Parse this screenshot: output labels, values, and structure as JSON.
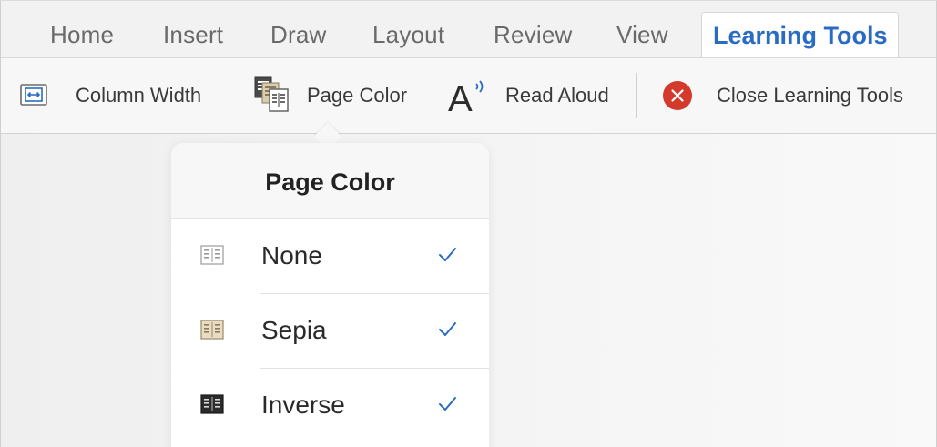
{
  "tabs": [
    {
      "label": "Home"
    },
    {
      "label": "Insert"
    },
    {
      "label": "Draw"
    },
    {
      "label": "Layout"
    },
    {
      "label": "Review"
    },
    {
      "label": "View"
    }
  ],
  "active_tab": {
    "label": "Learning Tools"
  },
  "ribbon": {
    "column_width": {
      "label": "Column Width",
      "icon": "column-width-icon"
    },
    "page_color": {
      "label": "Page Color",
      "icon": "page-color-icon"
    },
    "read_aloud": {
      "label": "Read Aloud",
      "icon": "read-aloud-icon"
    },
    "close": {
      "label": "Close Learning Tools",
      "icon": "close-circle-icon"
    }
  },
  "popover": {
    "title": "Page Color",
    "options": [
      {
        "label": "None",
        "checked": true,
        "icon": "page-none-icon"
      },
      {
        "label": "Sepia",
        "checked": true,
        "icon": "page-sepia-icon"
      },
      {
        "label": "Inverse",
        "checked": true,
        "icon": "page-inverse-icon"
      }
    ]
  },
  "colors": {
    "accent": "#2a6bc4",
    "close_red": "#d33a2c",
    "check_blue": "#2a6bc4",
    "sepia": "#e9dcc4",
    "inverse": "#2b2b2b"
  }
}
